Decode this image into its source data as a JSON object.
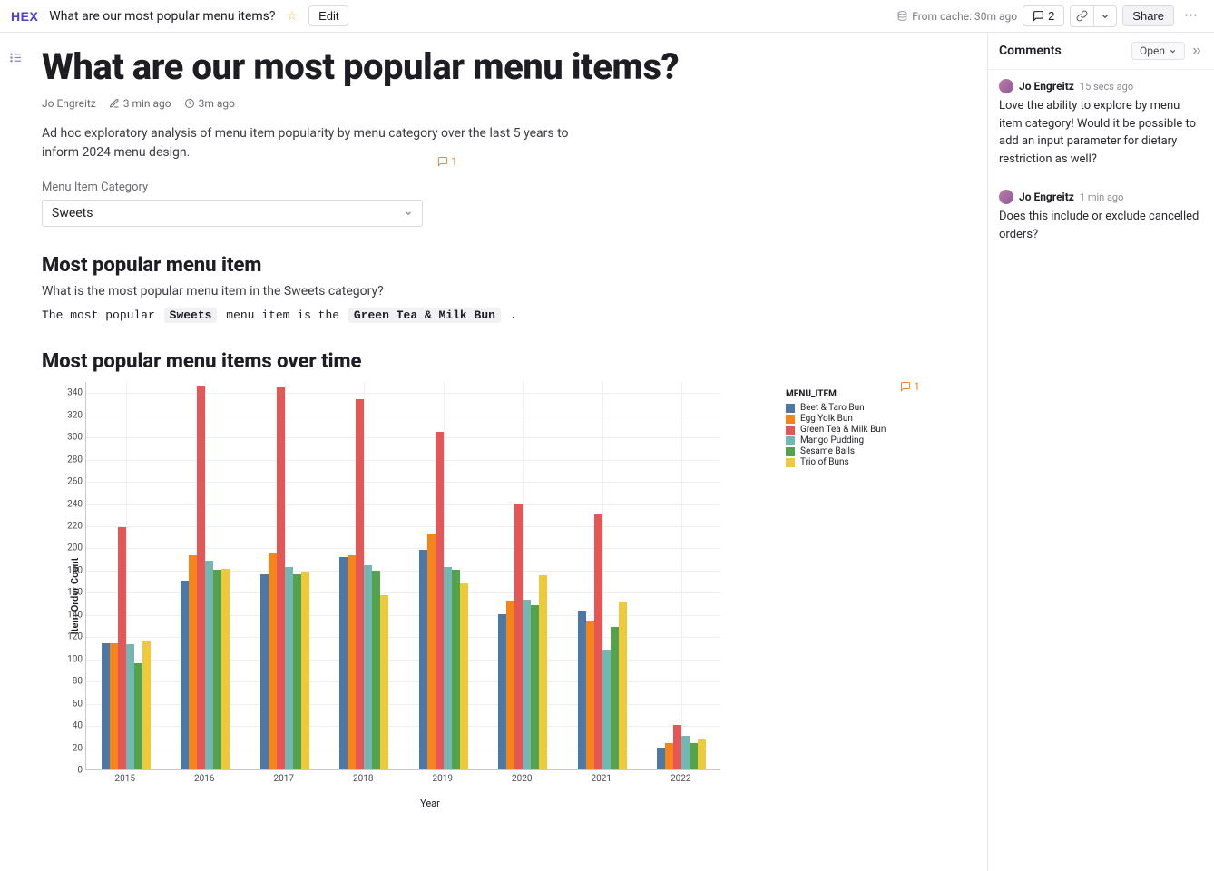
{
  "topbar": {
    "logo": "HEX",
    "project_title": "What are our most popular menu items?",
    "edit_label": "Edit",
    "cache_label": "From cache: 30m ago",
    "comment_count": "2",
    "share_label": "Share"
  },
  "page": {
    "title": "What are our most popular menu items?",
    "author": "Jo Engreitz",
    "edited_ago": "3 min ago",
    "run_ago": "3m ago",
    "description": "Ad hoc exploratory analysis of menu item popularity by menu category over the last 5 years to inform 2024 menu design.",
    "desc_comment_count": "1"
  },
  "param": {
    "label": "Menu Item Category",
    "value": "Sweets"
  },
  "section1": {
    "heading": "Most popular menu item",
    "question": "What is the most popular menu item in the Sweets category?",
    "answer_prefix": "The most popular",
    "answer_token1": "Sweets",
    "answer_mid": "menu item is the",
    "answer_token2": "Green Tea & Milk Bun",
    "answer_suffix": "."
  },
  "section2": {
    "heading": "Most popular menu items over time",
    "comment_count": "1"
  },
  "comments_panel": {
    "title": "Comments",
    "filter_label": "Open",
    "items": [
      {
        "author": "Jo Engreitz",
        "time": "15 secs ago",
        "body": "Love the ability to explore by menu item category! Would it be possible to add an input parameter for dietary restriction as well?"
      },
      {
        "author": "Jo Engreitz",
        "time": "1 min ago",
        "body": "Does this include or exclude cancelled orders?"
      }
    ]
  },
  "chart_data": {
    "type": "bar",
    "xlabel": "Year",
    "ylabel": "Item Order Count",
    "ylim": [
      0,
      350
    ],
    "ytick_interval": 20,
    "legend_title": "MENU_ITEM",
    "categories": [
      "2015",
      "2016",
      "2017",
      "2018",
      "2019",
      "2020",
      "2021",
      "2022"
    ],
    "series": [
      {
        "name": "Beet & Taro Bun",
        "color": "#4c78a8",
        "values": [
          114,
          170,
          176,
          191,
          198,
          140,
          143,
          20
        ]
      },
      {
        "name": "Egg Yolk Bun",
        "color": "#f58518",
        "values": [
          114,
          193,
          195,
          193,
          212,
          152,
          133,
          24
        ]
      },
      {
        "name": "Green Tea & Milk Bun",
        "color": "#e45756",
        "values": [
          218,
          346,
          344,
          334,
          304,
          240,
          230,
          40
        ]
      },
      {
        "name": "Mango Pudding",
        "color": "#72b7b2",
        "values": [
          113,
          188,
          182,
          184,
          182,
          153,
          108,
          30
        ]
      },
      {
        "name": "Sesame Balls",
        "color": "#54a24b",
        "values": [
          96,
          180,
          176,
          179,
          180,
          148,
          128,
          24
        ]
      },
      {
        "name": "Trio of Buns",
        "color": "#eeca3b",
        "values": [
          116,
          181,
          178,
          157,
          168,
          175,
          151,
          27
        ]
      }
    ]
  }
}
